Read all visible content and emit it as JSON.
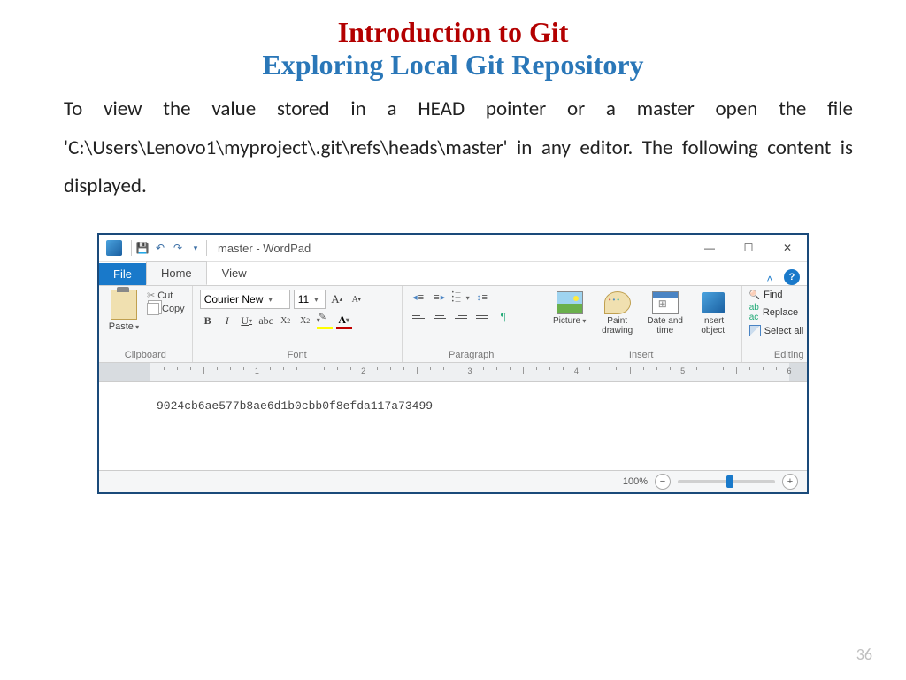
{
  "slide": {
    "title1": "Introduction to Git",
    "title2": "Exploring Local Git Repository",
    "body": "To view the value stored in a HEAD pointer or a master open the file 'C:\\Users\\Lenovo1\\myproject\\.git\\refs\\heads\\master' in any editor. The following content is displayed.",
    "page_number": "36"
  },
  "wordpad": {
    "titlebar": {
      "app_title": "master - WordPad"
    },
    "tabs": {
      "file": "File",
      "home": "Home",
      "view": "View"
    },
    "ribbon": {
      "clipboard": {
        "paste": "Paste",
        "cut": "Cut",
        "copy": "Copy",
        "group_label": "Clipboard"
      },
      "font": {
        "font_name": "Courier New",
        "font_size": "11",
        "group_label": "Font"
      },
      "paragraph": {
        "group_label": "Paragraph"
      },
      "insert": {
        "picture": "Picture",
        "paint": "Paint drawing",
        "datetime": "Date and time",
        "object": "Insert object",
        "group_label": "Insert"
      },
      "editing": {
        "find": "Find",
        "replace": "Replace",
        "select_all": "Select all",
        "group_label": "Editing"
      }
    },
    "document": {
      "content": "9024cb6ae577b8ae6d1b0cbb0f8efda117a73499"
    },
    "status": {
      "zoom": "100%"
    }
  }
}
